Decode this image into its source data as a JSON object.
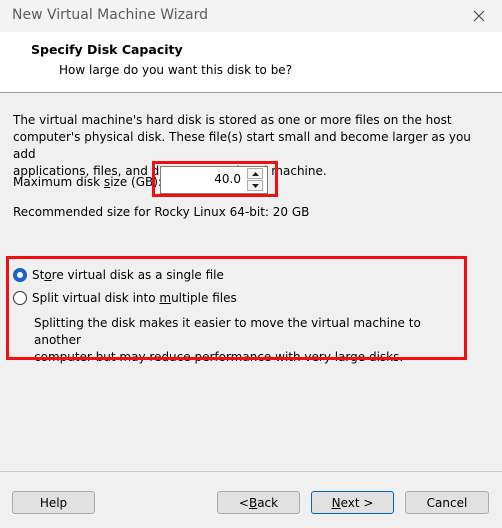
{
  "window": {
    "title": "New Virtual Machine Wizard"
  },
  "header": {
    "title": "Specify Disk Capacity",
    "subtitle": "How large do you want this disk to be?"
  },
  "description": {
    "line1": "The virtual machine's hard disk is stored as one or more files on the host",
    "line2": "computer's physical disk. These file(s) start small and become larger as you add",
    "line3": "applications, files, and data to your virtual machine."
  },
  "disk_size": {
    "label_pre": "Maximum disk ",
    "label_mnemonic": "s",
    "label_post": "ize (GB):",
    "value": "40.0"
  },
  "recommendation": "Recommended size for Rocky Linux 64-bit: 20 GB",
  "storage_options": {
    "single": {
      "pre": "St",
      "mnemonic": "o",
      "post": "re virtual disk as a single file",
      "checked": true
    },
    "split": {
      "pre": "Split virtual disk into ",
      "mnemonic": "m",
      "post": "ultiple files",
      "checked": false
    },
    "note_line1": "Splitting the disk makes it easier to move the virtual machine to another",
    "note_line2": "computer but may reduce performance with very large disks."
  },
  "buttons": {
    "help": "Help",
    "back_pre": "< ",
    "back_mnemonic": "B",
    "back_post": "ack",
    "next_mnemonic": "N",
    "next_post": "ext >",
    "cancel": "Cancel"
  },
  "colors": {
    "highlight": "#ee1111",
    "radio_accent": "#1a66c2",
    "default_button_border": "#0067c0"
  }
}
